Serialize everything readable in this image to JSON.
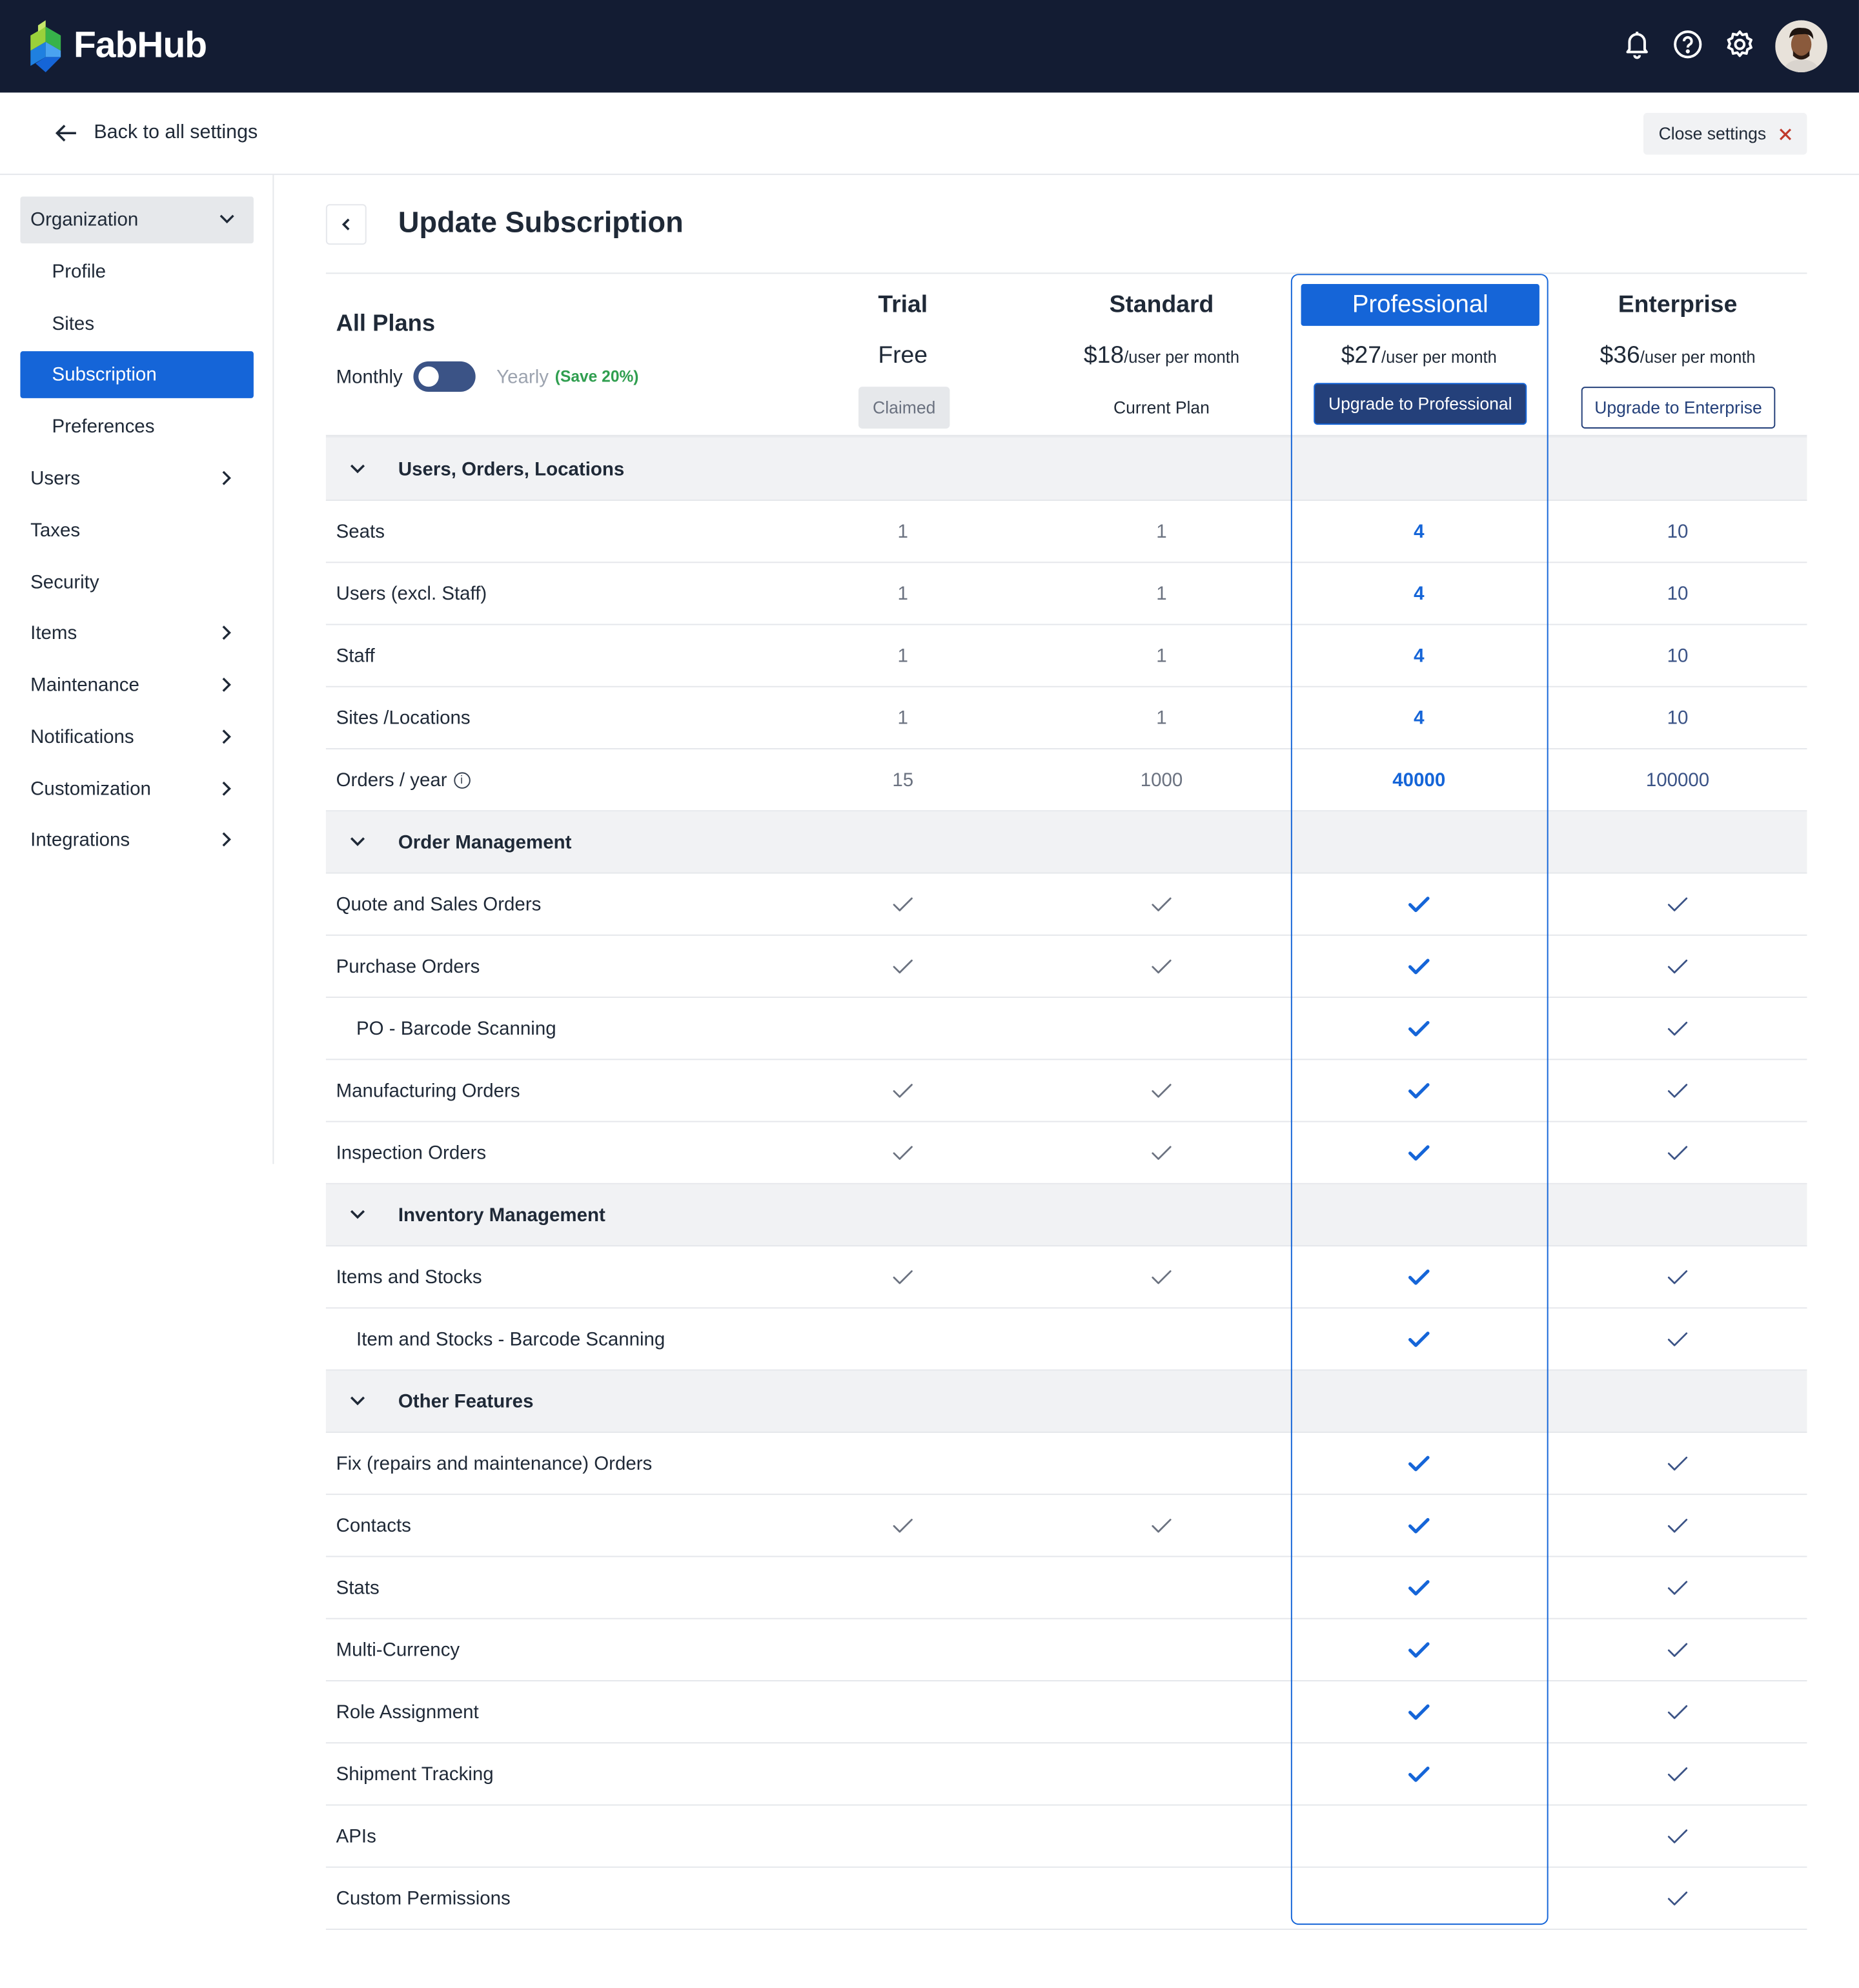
{
  "app": {
    "name": "FabHub"
  },
  "header": {
    "icons": [
      "bell-icon",
      "help-icon",
      "gear-icon"
    ]
  },
  "subheader": {
    "back_label": "Back to all settings",
    "close_label": "Close settings"
  },
  "sidebar": {
    "items": [
      {
        "label": "Organization",
        "type": "group",
        "chevron": "down"
      },
      {
        "label": "Profile",
        "type": "sub"
      },
      {
        "label": "Sites",
        "type": "sub"
      },
      {
        "label": "Subscription",
        "type": "sub",
        "active": true
      },
      {
        "label": "Preferences",
        "type": "sub"
      },
      {
        "label": "Users",
        "chevron": "right"
      },
      {
        "label": "Taxes"
      },
      {
        "label": "Security"
      },
      {
        "label": "Items",
        "chevron": "right"
      },
      {
        "label": "Maintenance",
        "chevron": "right"
      },
      {
        "label": "Notifications",
        "chevron": "right"
      },
      {
        "label": "Customization",
        "chevron": "right"
      },
      {
        "label": "Integrations",
        "chevron": "right"
      }
    ]
  },
  "page": {
    "title": "Update Subscription"
  },
  "plans_header": {
    "all_plans": "All Plans",
    "monthly": "Monthly",
    "yearly": "Yearly",
    "save": "(Save 20%)"
  },
  "plans": [
    {
      "name": "Trial",
      "price": "Free",
      "per": "",
      "action": "Claimed"
    },
    {
      "name": "Standard",
      "price": "$18",
      "per": "/user per month",
      "action": "Current Plan"
    },
    {
      "name": "Professional",
      "price": "$27",
      "per": "/user per month",
      "action": "Upgrade to Professional"
    },
    {
      "name": "Enterprise",
      "price": "$36",
      "per": "/user per month",
      "action": "Upgrade to Enterprise"
    }
  ],
  "rows": [
    {
      "type": "section",
      "label": "Users, Orders, Locations"
    },
    {
      "label": "Seats",
      "values": [
        "1",
        "1",
        "4",
        "10"
      ]
    },
    {
      "label": "Users (excl. Staff)",
      "values": [
        "1",
        "1",
        "4",
        "10"
      ]
    },
    {
      "label": "Staff",
      "values": [
        "1",
        "1",
        "4",
        "10"
      ]
    },
    {
      "label": "Sites /Locations",
      "values": [
        "1",
        "1",
        "4",
        "10"
      ]
    },
    {
      "label": "Orders / year",
      "info": true,
      "values": [
        "15",
        "1000",
        "40000",
        "100000"
      ]
    },
    {
      "type": "section",
      "label": "Order Management"
    },
    {
      "label": "Quote and Sales Orders",
      "checks": [
        true,
        true,
        true,
        true
      ]
    },
    {
      "label": "Purchase Orders",
      "checks": [
        true,
        true,
        true,
        true
      ]
    },
    {
      "label": "PO - Barcode Scanning",
      "indent": true,
      "checks": [
        false,
        false,
        true,
        true
      ]
    },
    {
      "label": "Manufacturing Orders",
      "checks": [
        true,
        true,
        true,
        true
      ]
    },
    {
      "label": "Inspection Orders",
      "checks": [
        true,
        true,
        true,
        true
      ]
    },
    {
      "type": "section",
      "label": "Inventory Management"
    },
    {
      "label": "Items and Stocks",
      "checks": [
        true,
        true,
        true,
        true
      ]
    },
    {
      "label": "Item and Stocks - Barcode Scanning",
      "indent": true,
      "checks": [
        false,
        false,
        true,
        true
      ]
    },
    {
      "type": "section",
      "label": "Other Features"
    },
    {
      "label": "Fix (repairs and maintenance) Orders",
      "checks": [
        false,
        false,
        true,
        true
      ]
    },
    {
      "label": "Contacts",
      "checks": [
        true,
        true,
        true,
        true
      ]
    },
    {
      "label": "Stats",
      "checks": [
        false,
        false,
        true,
        true
      ]
    },
    {
      "label": "Multi-Currency",
      "checks": [
        false,
        false,
        true,
        true
      ]
    },
    {
      "label": "Role Assignment",
      "checks": [
        false,
        false,
        true,
        true
      ]
    },
    {
      "label": "Shipment Tracking",
      "checks": [
        false,
        false,
        true,
        true
      ]
    },
    {
      "label": "APIs",
      "checks": [
        false,
        false,
        false,
        true
      ]
    },
    {
      "label": "Custom Permissions",
      "checks": [
        false,
        false,
        false,
        true
      ]
    }
  ],
  "colors": {
    "topbar": "#131c33",
    "accent": "#1565d8",
    "navy": "#24407a",
    "save_green": "#2f9e4f"
  }
}
